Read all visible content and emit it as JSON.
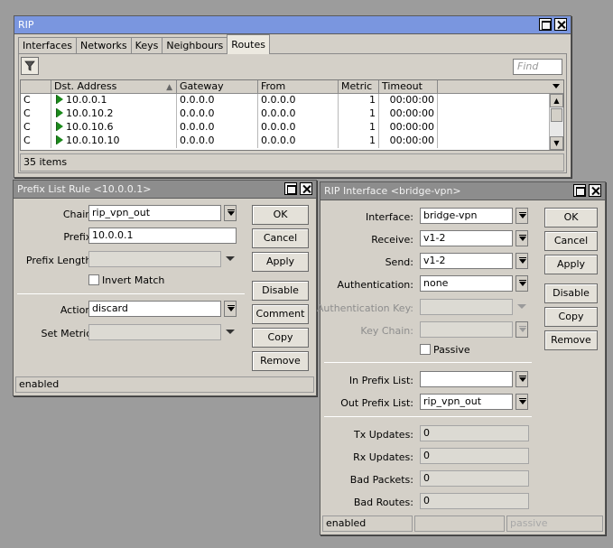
{
  "rip_window": {
    "title": "RIP",
    "tabs": [
      "Interfaces",
      "Networks",
      "Keys",
      "Neighbours",
      "Routes"
    ],
    "active_tab": "Routes",
    "find_placeholder": "Find",
    "columns": [
      "",
      "Dst. Address",
      "Gateway",
      "From",
      "Metric",
      "Timeout"
    ],
    "rows": [
      {
        "flag": "C",
        "dst": "10.0.0.1",
        "gateway": "0.0.0.0",
        "from": "0.0.0.0",
        "metric": "1",
        "timeout": "00:00:00"
      },
      {
        "flag": "C",
        "dst": "10.0.10.2",
        "gateway": "0.0.0.0",
        "from": "0.0.0.0",
        "metric": "1",
        "timeout": "00:00:00"
      },
      {
        "flag": "C",
        "dst": "10.0.10.6",
        "gateway": "0.0.0.0",
        "from": "0.0.0.0",
        "metric": "1",
        "timeout": "00:00:00"
      },
      {
        "flag": "C",
        "dst": "10.0.10.10",
        "gateway": "0.0.0.0",
        "from": "0.0.0.0",
        "metric": "1",
        "timeout": "00:00:00"
      }
    ],
    "status": "35 items"
  },
  "prefix_window": {
    "title": "Prefix List Rule <10.0.0.1>",
    "chain_label": "Chain:",
    "chain_value": "rip_vpn_out",
    "prefix_label": "Prefix:",
    "prefix_value": "10.0.0.1",
    "prefix_length_label": "Prefix Length:",
    "prefix_length_value": "",
    "invert_match_label": "Invert Match",
    "action_label": "Action:",
    "action_value": "discard",
    "set_metric_label": "Set Metric:",
    "set_metric_value": "",
    "buttons": {
      "ok": "OK",
      "cancel": "Cancel",
      "apply": "Apply",
      "disable": "Disable",
      "comment": "Comment",
      "copy": "Copy",
      "remove": "Remove"
    },
    "status": "enabled"
  },
  "rip_iface_window": {
    "title": "RIP Interface <bridge-vpn>",
    "interface_label": "Interface:",
    "interface_value": "bridge-vpn",
    "receive_label": "Receive:",
    "receive_value": "v1-2",
    "send_label": "Send:",
    "send_value": "v1-2",
    "authentication_label": "Authentication:",
    "authentication_value": "none",
    "auth_key_label": "Authentication Key:",
    "auth_key_value": "",
    "key_chain_label": "Key Chain:",
    "key_chain_value": "",
    "passive_label": "Passive",
    "in_prefix_label": "In Prefix List:",
    "in_prefix_value": "",
    "out_prefix_label": "Out Prefix List:",
    "out_prefix_value": "rip_vpn_out",
    "tx_updates_label": "Tx Updates:",
    "tx_updates_value": "0",
    "rx_updates_label": "Rx Updates:",
    "rx_updates_value": "0",
    "bad_packets_label": "Bad Packets:",
    "bad_packets_value": "0",
    "bad_routes_label": "Bad Routes:",
    "bad_routes_value": "0",
    "buttons": {
      "ok": "OK",
      "cancel": "Cancel",
      "apply": "Apply",
      "disable": "Disable",
      "copy": "Copy",
      "remove": "Remove"
    },
    "status": "enabled",
    "status_passive": "passive"
  }
}
